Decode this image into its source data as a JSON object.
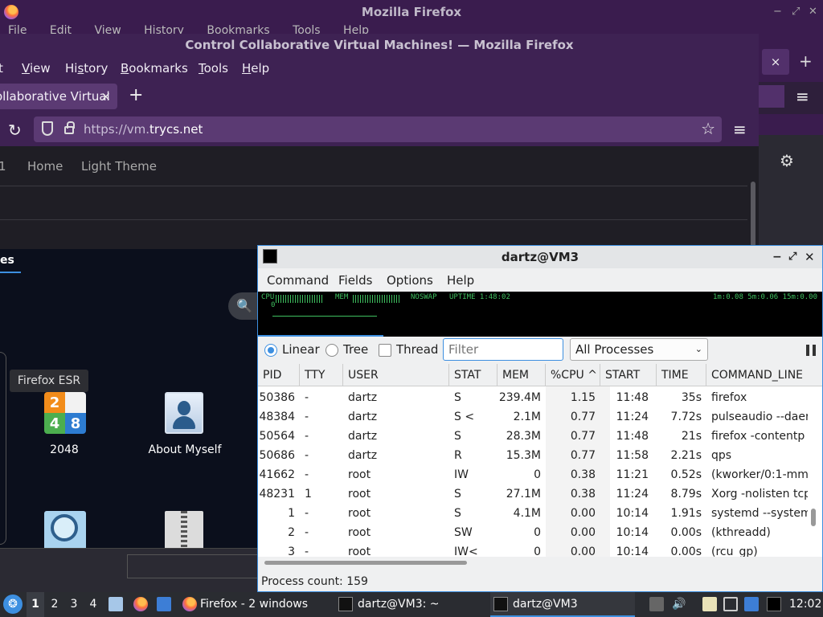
{
  "back_window": {
    "title": "Mozilla Firefox",
    "menu": [
      "File",
      "Edit",
      "View",
      "History",
      "Bookmarks",
      "Tools",
      "Help"
    ],
    "tab_close": "×",
    "new_tab": "+",
    "menu_icon": "≡",
    "settings_icon": "⚙"
  },
  "firefox": {
    "title": "Control Collaborative Virtual Machines! — Mozilla Firefox",
    "menu": [
      {
        "pre": "",
        "u": "",
        "post": "t"
      },
      {
        "pre": "",
        "u": "V",
        "post": "iew"
      },
      {
        "pre": "Hi",
        "u": "s",
        "post": "tory"
      },
      {
        "pre": "",
        "u": "B",
        "post": "ookmarks"
      },
      {
        "pre": "",
        "u": "T",
        "post": "ools"
      },
      {
        "pre": "",
        "u": "H",
        "post": "elp"
      }
    ],
    "tab_label": "ollaborative Virtual",
    "tab_close": "×",
    "new_tab": "+",
    "url_prefix": "https://vm.",
    "url_domain": "trycs.net",
    "nav_links": [
      "1",
      "Home",
      "Light Theme"
    ],
    "reload_icon": "↻",
    "star_icon": "☆",
    "menu_icon": "≡"
  },
  "vm_desktop": {
    "tab_label": "es",
    "search_icon": "🔍",
    "tooltip": "Firefox ESR",
    "icons": [
      {
        "label": "2048",
        "tiles": [
          "2",
          "",
          "4",
          "8"
        ]
      },
      {
        "label": "About Myself"
      }
    ]
  },
  "qps": {
    "title": "dartz@VM3",
    "window_controls": {
      "minimize": "−",
      "maximize": "⤢",
      "close": "✕"
    },
    "menu": [
      "Command",
      "Fields",
      "Options",
      "Help"
    ],
    "graph": {
      "cpu_label": "CPU",
      "cpu_value": "0",
      "mem_label": "MEM",
      "swap_label": "NOSWAP",
      "uptime": "UPTIME 1:48:02",
      "load": "1m:0.08 5m:0.06 15m:0.00"
    },
    "view_modes": [
      "Linear",
      "Tree"
    ],
    "thread_label": "Thread",
    "filter_placeholder": "Filter",
    "process_filter": "All Processes",
    "select_arrow": "⌄",
    "columns": [
      "PID",
      "TTY",
      "USER",
      "STAT",
      "MEM",
      "%CPU",
      "START",
      "TIME",
      "COMMAND_LINE"
    ],
    "sort_indicator": "^",
    "rows": [
      {
        "pid": "50386",
        "tty": "-",
        "user": "dartz",
        "stat": "S",
        "mem": "239.4M",
        "cpu": "1.15",
        "start": "11:48",
        "time": "35s",
        "cmd": "firefox"
      },
      {
        "pid": "48384",
        "tty": "-",
        "user": "dartz",
        "stat": "S <",
        "mem": "2.1M",
        "cpu": "0.77",
        "start": "11:24",
        "time": "7.72s",
        "cmd": "pulseaudio --daer"
      },
      {
        "pid": "50564",
        "tty": "-",
        "user": "dartz",
        "stat": "S",
        "mem": "28.3M",
        "cpu": "0.77",
        "start": "11:48",
        "time": "21s",
        "cmd": "firefox -contentp"
      },
      {
        "pid": "50686",
        "tty": "-",
        "user": "dartz",
        "stat": "R",
        "mem": "15.3M",
        "cpu": "0.77",
        "start": "11:58",
        "time": "2.21s",
        "cmd": "qps"
      },
      {
        "pid": "41662",
        "tty": "-",
        "user": "root",
        "stat": "IW",
        "mem": "0",
        "cpu": "0.38",
        "start": "11:21",
        "time": "0.52s",
        "cmd": "(kworker/0:1-mm"
      },
      {
        "pid": "48231",
        "tty": "1",
        "user": "root",
        "stat": "S",
        "mem": "27.1M",
        "cpu": "0.38",
        "start": "11:24",
        "time": "8.79s",
        "cmd": "Xorg -nolisten tcp"
      },
      {
        "pid": "1",
        "tty": "-",
        "user": "root",
        "stat": "S",
        "mem": "4.1M",
        "cpu": "0.00",
        "start": "10:14",
        "time": "1.91s",
        "cmd": "systemd --system"
      },
      {
        "pid": "2",
        "tty": "-",
        "user": "root",
        "stat": "SW",
        "mem": "0",
        "cpu": "0.00",
        "start": "10:14",
        "time": "0.00s",
        "cmd": "(kthreadd)"
      },
      {
        "pid": "3",
        "tty": "-",
        "user": "root",
        "stat": "IW<",
        "mem": "0",
        "cpu": "0.00",
        "start": "10:14",
        "time": "0.00s",
        "cmd": "(rcu_gp)"
      }
    ],
    "status": "Process count: 159"
  },
  "taskbar": {
    "start_icon": "❂",
    "workspaces": [
      "1",
      "2",
      "3",
      "4"
    ],
    "tasks": [
      "Firefox - 2 windows",
      "dartz@VM3: ~",
      "dartz@VM3"
    ],
    "tray": {
      "speaker_icon": "🔊"
    },
    "clock": "12:02"
  },
  "colors": {
    "firefox_chrome": "#3e2253",
    "firefox_url_bar": "#5b3a73",
    "accent": "#3d8fe0",
    "graph_green": "#3fbf5f"
  }
}
